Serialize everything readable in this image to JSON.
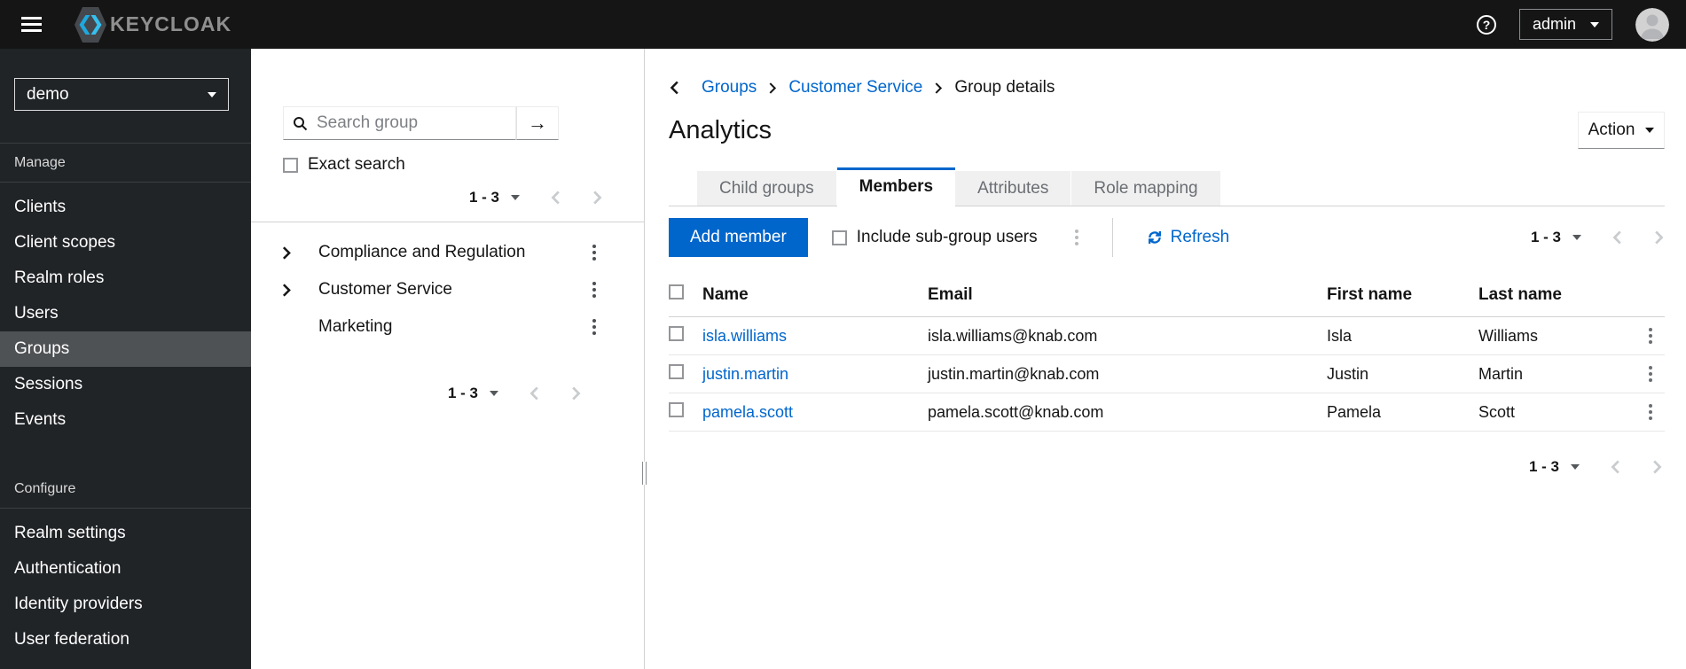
{
  "masthead": {
    "brand": "KEYCLOAK",
    "username": "admin"
  },
  "icons": {
    "search_submit_arrow": "→",
    "help_glyph": "?"
  },
  "sidebar": {
    "realm": "demo",
    "manage_label": "Manage",
    "manage_items": [
      "Clients",
      "Client scopes",
      "Realm roles",
      "Users",
      "Groups",
      "Sessions",
      "Events"
    ],
    "selected_item": "Groups",
    "configure_label": "Configure",
    "configure_items": [
      "Realm settings",
      "Authentication",
      "Identity providers",
      "User federation"
    ]
  },
  "tree": {
    "search_placeholder": "Search group",
    "exact_search_label": "Exact search",
    "pagination_top_range": "1 - 3",
    "pagination_bottom_range": "1 - 3",
    "groups": [
      {
        "name": "Compliance and Regulation",
        "expandable": true
      },
      {
        "name": "Customer Service",
        "expandable": true
      },
      {
        "name": "Marketing",
        "expandable": false
      }
    ]
  },
  "main": {
    "breadcrumb": {
      "items": [
        "Groups",
        "Customer Service",
        "Group details"
      ]
    },
    "title": "Analytics",
    "action_label": "Action",
    "tabs": [
      "Child groups",
      "Members",
      "Attributes",
      "Role mapping"
    ],
    "active_tab": "Members",
    "toolbar": {
      "add_member_label": "Add member",
      "include_subgroup_label": "Include sub-group users",
      "refresh_label": "Refresh",
      "pagination_range": "1 - 3"
    },
    "table": {
      "headers": [
        "Name",
        "Email",
        "First name",
        "Last name"
      ],
      "rows": [
        {
          "name": "isla.williams",
          "email": "isla.williams@knab.com",
          "first_name": "Isla",
          "last_name": "Williams"
        },
        {
          "name": "justin.martin",
          "email": "justin.martin@knab.com",
          "first_name": "Justin",
          "last_name": "Martin"
        },
        {
          "name": "pamela.scott",
          "email": "pamela.scott@knab.com",
          "first_name": "Pamela",
          "last_name": "Scott"
        }
      ]
    },
    "table_pagination_range": "1 - 3"
  },
  "colors": {
    "accent": "#0066cc",
    "link": "#0066cc",
    "masthead_bg": "#151515",
    "sidebar_bg": "#212427",
    "sidebar_selected_bg": "#4f5255",
    "tab_inactive_bg": "#f0f0f0",
    "border": "#d2d2d2"
  }
}
